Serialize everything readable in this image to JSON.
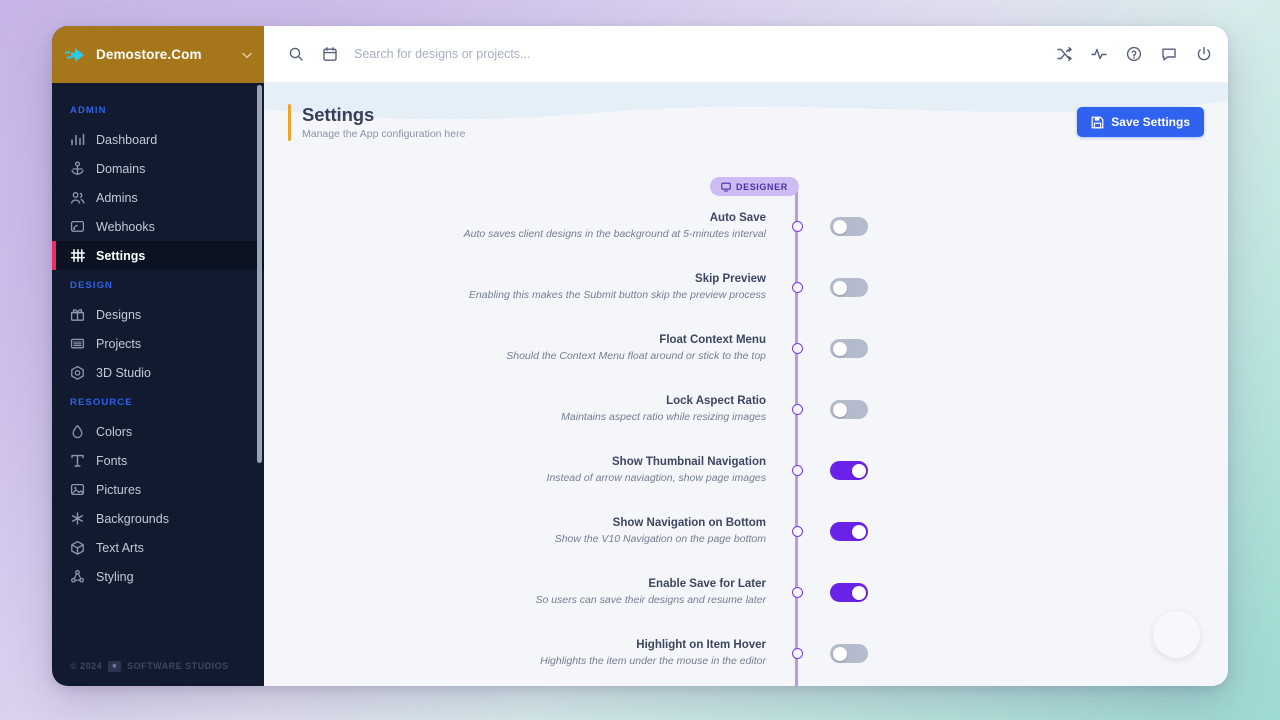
{
  "brand": {
    "name": "Demostore.Com",
    "logo_icon": "arrow-forward-icon",
    "caret_icon": "chevron-down-icon",
    "bg_color": "#a6761a"
  },
  "sidebar": {
    "sections": [
      {
        "title": "ADMIN",
        "items": [
          {
            "label": "Dashboard",
            "icon": "bar-chart-icon",
            "active": false
          },
          {
            "label": "Domains",
            "icon": "anchor-icon",
            "active": false
          },
          {
            "label": "Admins",
            "icon": "users-icon",
            "active": false
          },
          {
            "label": "Webhooks",
            "icon": "webhook-icon",
            "active": false
          },
          {
            "label": "Settings",
            "icon": "sliders-icon",
            "active": true
          }
        ]
      },
      {
        "title": "DESIGN",
        "items": [
          {
            "label": "Designs",
            "icon": "gift-icon",
            "active": false
          },
          {
            "label": "Projects",
            "icon": "layers-icon",
            "active": false
          },
          {
            "label": "3D Studio",
            "icon": "cube-icon",
            "active": false
          }
        ]
      },
      {
        "title": "RESOURCE",
        "items": [
          {
            "label": "Colors",
            "icon": "droplet-icon",
            "active": false
          },
          {
            "label": "Fonts",
            "icon": "type-icon",
            "active": false
          },
          {
            "label": "Pictures",
            "icon": "image-icon",
            "active": false
          },
          {
            "label": "Backgrounds",
            "icon": "grid-dots-icon",
            "active": false
          },
          {
            "label": "Text Arts",
            "icon": "box-3d-icon",
            "active": false
          },
          {
            "label": "Styling",
            "icon": "nodes-icon",
            "active": false
          }
        ]
      }
    ],
    "footer": {
      "copyright": "© 2024",
      "badge_icon": "studio-logo-icon",
      "company": "SOFTWARE STUDIOS"
    },
    "active_indicator_color": "#ec2a63"
  },
  "topbar": {
    "search_icon": "search-icon",
    "calendar_icon": "calendar-icon",
    "search_value": "",
    "search_placeholder": "Search for designs or projects...",
    "actions": [
      {
        "icon": "shuffle-icon"
      },
      {
        "icon": "activity-pulse-icon"
      },
      {
        "icon": "help-circle-icon"
      },
      {
        "icon": "message-square-icon"
      },
      {
        "icon": "power-icon"
      }
    ]
  },
  "page_header": {
    "title": "Settings",
    "subtitle": "Manage the App configuration here",
    "accent_color": "#f2a22b",
    "save_button": {
      "label": "Save Settings",
      "icon": "save-floppy-icon",
      "color": "#2f62ef"
    }
  },
  "settings": {
    "group_badge": {
      "label": "DESIGNER",
      "icon": "monitor-icon",
      "bg_color": "#cdbcf4",
      "text_color": "#4a2fa8"
    },
    "timeline_color": "#b79af0",
    "toggle_on_color": "#6a21e8",
    "toggle_off_color": "#b3bbcc",
    "rows": [
      {
        "label": "Auto Save",
        "description": "Auto saves client designs in the background at 5-minutes interval",
        "enabled": false
      },
      {
        "label": "Skip Preview",
        "description": "Enabling this makes the Submit button skip the preview process",
        "enabled": false
      },
      {
        "label": "Float Context Menu",
        "description": "Should the Context Menu float around or stick to the top",
        "enabled": false
      },
      {
        "label": "Lock Aspect Ratio",
        "description": "Maintains aspect ratio while resizing images",
        "enabled": false
      },
      {
        "label": "Show Thumbnail Navigation",
        "description": "Instead of arrow naviagtion, show page images",
        "enabled": true
      },
      {
        "label": "Show Navigation on Bottom",
        "description": "Show the V10 Navigation on the page bottom",
        "enabled": true
      },
      {
        "label": "Enable Save for Later",
        "description": "So users can save their designs and resume later",
        "enabled": true
      },
      {
        "label": "Highlight on Item Hover",
        "description": "Highlights the item under the mouse in the editor",
        "enabled": false
      }
    ]
  },
  "help_bubble": {
    "icon": "help-widget-icon"
  }
}
